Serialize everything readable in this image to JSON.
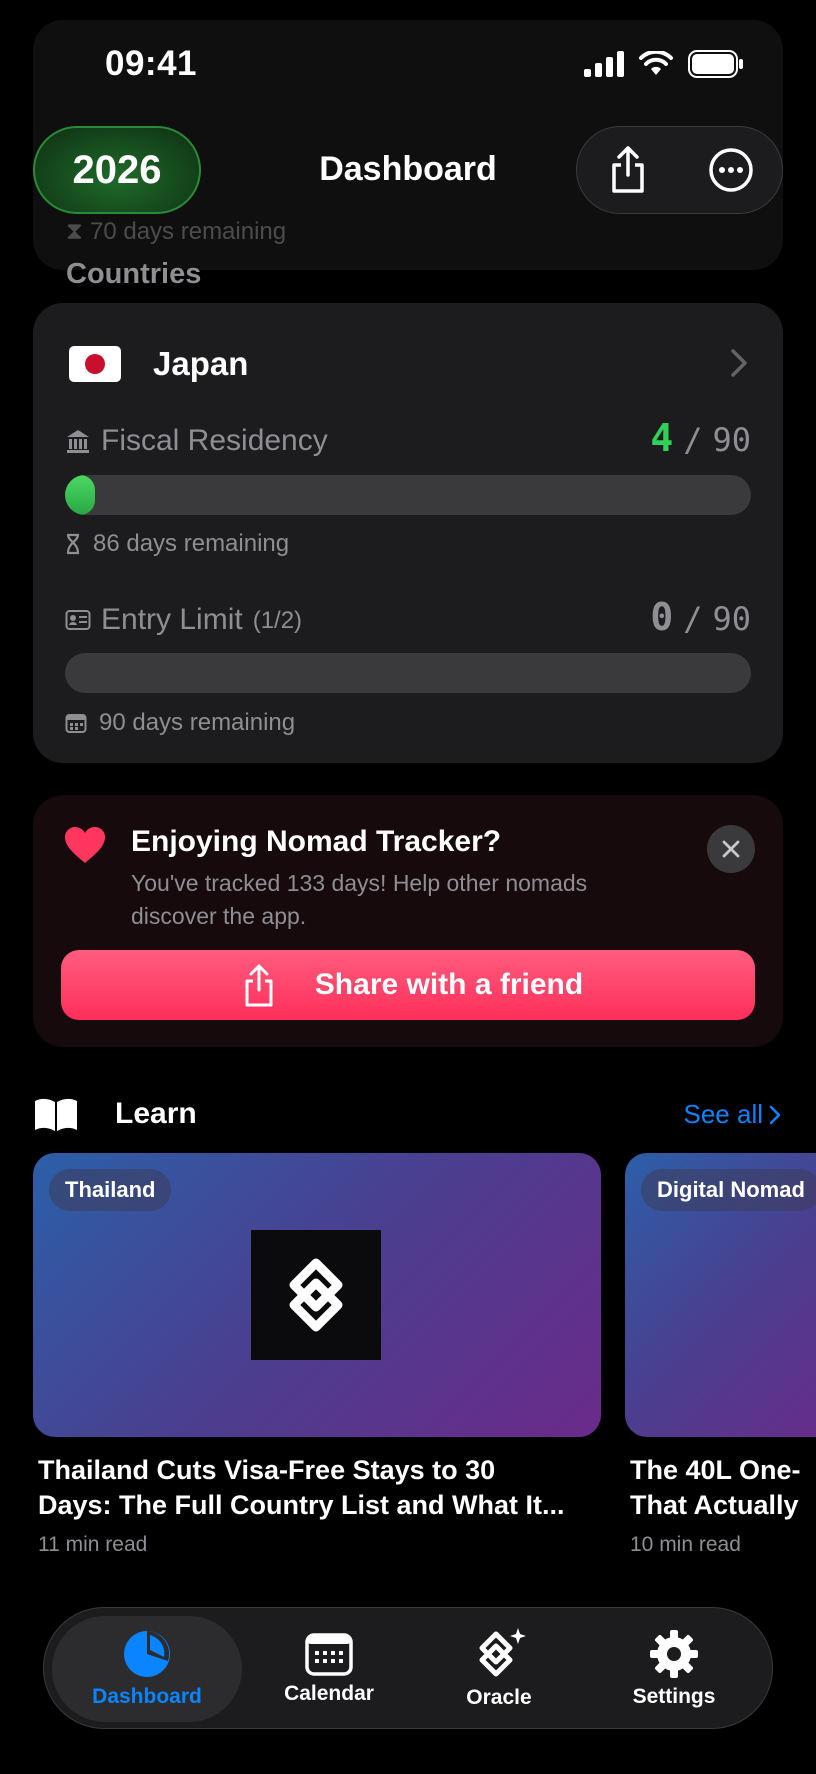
{
  "status_bar": {
    "time": "09:41"
  },
  "ghost": {
    "remaining": "70 days remaining"
  },
  "header": {
    "year": "2026",
    "title": "Dashboard",
    "share_icon": "share-icon",
    "more_icon": "ellipsis-icon"
  },
  "countries_section": {
    "label": "Countries"
  },
  "country": {
    "name": "Japan",
    "flag": "japan-flag",
    "fiscal": {
      "label": "Fiscal Residency",
      "current": "4",
      "max": "90",
      "separator": "/",
      "progress": 0.044,
      "remaining": "86 days remaining",
      "color": "#30d158"
    },
    "entry": {
      "label": "Entry Limit",
      "sub": "(1/2)",
      "current": "0",
      "max": "90",
      "separator": "/",
      "progress": 0,
      "remaining": "90 days remaining"
    }
  },
  "promo": {
    "title": "Enjoying Nomad Tracker?",
    "body": "You've tracked 133 days! Help other nomads discover the app.",
    "button": "Share with a friend",
    "accent": "#ff375f"
  },
  "learn": {
    "title": "Learn",
    "see_all": "See all",
    "articles": [
      {
        "tag": "Thailand",
        "title_line1": "Thailand Cuts Visa-Free Stays to 30",
        "title_line2": "Days: The Full Country List and What It...",
        "meta": "11 min read"
      },
      {
        "tag": "Digital Nomad",
        "title_line1": "The 40L One-",
        "title_line2": "That Actually",
        "meta": "10 min read"
      }
    ]
  },
  "tabs": [
    {
      "label": "Dashboard",
      "icon": "pie-chart-icon",
      "active": true
    },
    {
      "label": "Calendar",
      "icon": "calendar-icon",
      "active": false
    },
    {
      "label": "Oracle",
      "icon": "oracle-icon",
      "active": false
    },
    {
      "label": "Settings",
      "icon": "gear-icon",
      "active": false
    }
  ],
  "colors": {
    "accent_blue": "#0a84ff",
    "green": "#30d158",
    "pink": "#ff375f"
  }
}
